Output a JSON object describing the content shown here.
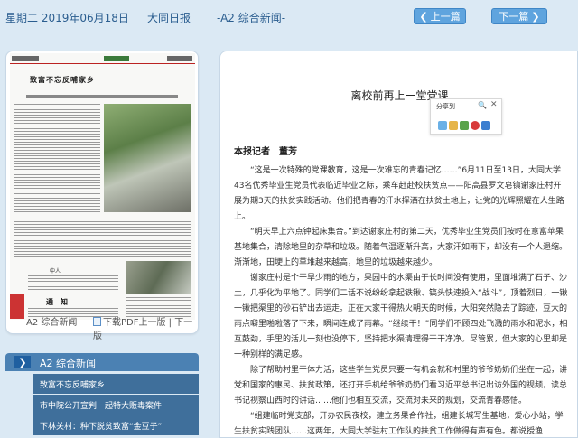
{
  "header": {
    "date": "星期二 2019年06月18日",
    "paper": "大同日报",
    "page": "-A2 综合新闻-",
    "prev_label": "上一篇",
    "next_label": "下一篇"
  },
  "thumbnail": {
    "headline": "致富不忘反哺家乡",
    "notice_label": "通　知",
    "caption": "中人"
  },
  "page_footer": {
    "section": "A2 综合新闻",
    "pdf_label": "下载PDF上一版",
    "next_page_label": "下一版"
  },
  "sections": {
    "title": "A2  综合新闻",
    "items": [
      "致富不忘反哺家乡",
      "市中院公开宣判一起特大贩毒案件",
      "下林关村：种下脱贫致富“金豆子”"
    ]
  },
  "share": {
    "label": "分享到"
  },
  "article": {
    "title": "离校前再上一堂党课",
    "byline": "本报记者　董芳",
    "paragraphs": [
      "“这是一次特殊的党课教育，这是一次难忘的青春记忆……”6月11日至13日，大同大学43名优秀毕业生党员代表临近毕业之际，乘车赶赴校扶贫点——阳高县罗文皂镇谢家庄村开展为期3天的扶贫实践活动。他们把青春的汗水挥洒在扶贫土地上，让党的光辉照耀在人生路上。",
      "“明天早上六点钟起床集合。”到达谢家庄村的第二天，优秀毕业生党员们按时在意富苹果基地集合，清除地里的杂草和垃圾。随着气温逐渐升高，大家汗如雨下，却没有一个人退缩。渐渐地，田埂上的草堆越来越高，地里的垃圾越来越少。",
      "谢家庄村是个干旱少雨的地方，果园中的水渠由于长时间没有使用，里面堆满了石子、沙土，几乎化为平地了。同学们二话不说纷纷拿起铁锹、镐头快速投入“战斗”，顶着烈日，一锹一锹把渠里的砂石铲出去运走。正在大家干得热火朝天的时候，大阳突然隐去了踪迹，豆大的雨点噼里啪啦落了下来，瞬间连成了雨幕。“继续干！”同学们不顾四处飞溅的雨水和泥水，相互鼓劲，手里的活儿一刻也没停下，坚持把水渠清理得干干净净。尽管累，但大家的心里却是一种别样的满足感。",
      "除了帮助村里干体力活，这些学生党员只要一有机会就和村里的爷爷奶奶们坐在一起，讲党和国家的惠民、扶贫政策，还打开手机给爷爷奶奶们看习近平总书记出访外国的视频，读总书记视察山西时的讲话……他们也相互交流，交流对未来的规划，交流青春感悟。",
      "“组建临时党支部，开办农民夜校，建立务果合作社，组建长城写生基地，爱心小站，学生扶贫实践团队……这两年，大同大学驻村工作队的扶贫工作做得有声有色。都说授渔"
    ]
  }
}
